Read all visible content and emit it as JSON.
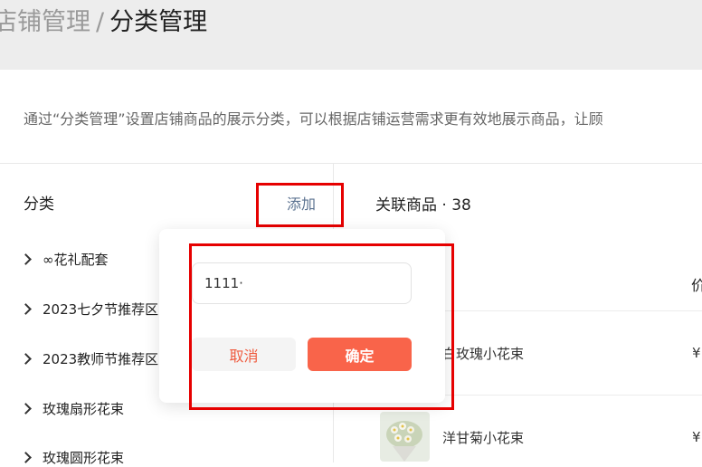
{
  "header": {
    "breadcrumb_parent": "店铺管理",
    "breadcrumb_separator": "/",
    "breadcrumb_current": "分类管理"
  },
  "intro_text": "通过“分类管理”设置店铺商品的展示分类，可以根据店铺运营需求更有效地展示商品，让顾",
  "category_panel": {
    "title": "分类",
    "add_label": "添加",
    "items": [
      {
        "label": "∞花礼配套"
      },
      {
        "label": "2023七夕节推荐区"
      },
      {
        "label": "2023教师节推荐区"
      },
      {
        "label": "玫瑰扇形花束"
      },
      {
        "label": "玫瑰圆形花束"
      }
    ]
  },
  "products_panel": {
    "title": "关联商品 · 38",
    "price_header": "价",
    "rows": [
      {
        "name": "白玫瑰小花束",
        "price": "¥"
      },
      {
        "name": "洋甘菊小花束",
        "price": "¥"
      }
    ]
  },
  "popover": {
    "input_value": "1111·",
    "cancel_label": "取消",
    "confirm_label": "确定"
  },
  "colors": {
    "accent": "#f9644a",
    "highlight": "#e60000",
    "link": "#5b7290"
  }
}
